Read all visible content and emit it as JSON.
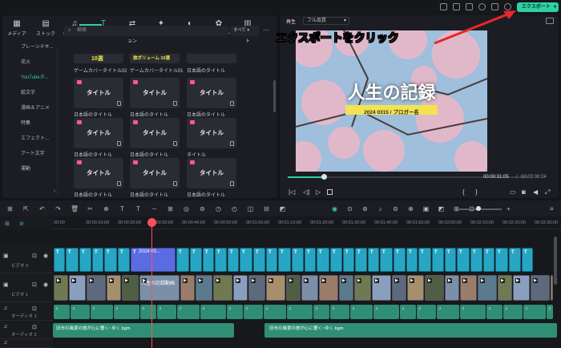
{
  "colors": {
    "accent": "#2fd0a2",
    "playhead": "#ff4d5e",
    "title_clip": "#27a6c4",
    "audio_clip": "#2f8f74",
    "annotation_arrow": "#e8262c"
  },
  "topbar": {
    "export_label": "エクスポート"
  },
  "tabs": [
    {
      "label": "メディア",
      "icon": "media-icon"
    },
    {
      "label": "ストック",
      "icon": "stock-icon"
    },
    {
      "label": "オーディオ",
      "icon": "music-icon"
    },
    {
      "label": "タイトル",
      "icon": "text-icon"
    },
    {
      "label": "トランジション",
      "icon": "transition-icon"
    },
    {
      "label": "エフェクト",
      "icon": "effect-icon"
    },
    {
      "label": "フィルター",
      "icon": "filter-icon"
    },
    {
      "label": "ステッカー",
      "icon": "sticker-icon"
    },
    {
      "label": "テンプレート",
      "icon": "template-icon"
    }
  ],
  "categories": [
    "ブレーンテキ...",
    "花火",
    "YouTubeタ...",
    "絵文字",
    "漫画＆アニメ",
    "特集",
    "エフェクト...",
    "アート文字",
    "運動"
  ],
  "search": {
    "placeholder": "検索",
    "sort": "すべて"
  },
  "grid": {
    "row0": {
      "thumbs": [
        "10選",
        "旅ボリューム 10選",
        ""
      ],
      "captions": [
        "ゲームカバータイトル02",
        "ゲームカバータイトル01",
        "日本語のタイトル"
      ]
    },
    "rows": [
      {
        "thumbs": [
          "タイトル",
          "タイトル",
          "タイトル"
        ],
        "captions": [
          "日本語のタイトル",
          "日本語のタイトル",
          "日本語のタイトル"
        ]
      },
      {
        "thumbs": [
          "タイトル",
          "タイトル",
          "タイトル"
        ],
        "captions": [
          "日本語のタイトル",
          "日本語のタイトル",
          "タイトル"
        ]
      },
      {
        "thumbs": [
          "タイトル",
          "タイトル",
          "タイトル"
        ],
        "captions": [
          "日本語のタイトル",
          "日本語のタイトル",
          "日本語のタイトル"
        ]
      }
    ]
  },
  "preview": {
    "mode": "再生",
    "quality": "フル品質",
    "title": "人生の記録",
    "subtitle": "2024 0315 / ブロガー名",
    "time_current": "00:00:31:05",
    "time_total": "00:03:08:24",
    "progress": 0.15
  },
  "annotation": "エクスポートをクリック",
  "ruler": [
    "00:00",
    "00:00:10:00",
    "00:00:20:00",
    "00:00:30:00",
    "00:00:40:00",
    "00:00:50:00",
    "00:01:00:00",
    "00:01:10:00",
    "00:01:20:00",
    "00:01:30:00",
    "00:01:40:00",
    "00:01:50:00",
    "00:02:00:00",
    "00:02:10:00",
    "00:02:20:00",
    "00:02:30:00"
  ],
  "tracks": {
    "video2": "ビデオ 2",
    "video1": "ビデオ 1",
    "audio1": "オーディオ 1",
    "audio2": "オーディオ 2"
  },
  "clips": {
    "title_clip": "2024 03...",
    "video_clip": "人生の記録動画",
    "audio_clip_1": "旧市の風景の旅が心に響く~ゆく.bgm",
    "audio_clip_2": "旧市の風景の旅が心に響く~ゆく.bgm"
  }
}
